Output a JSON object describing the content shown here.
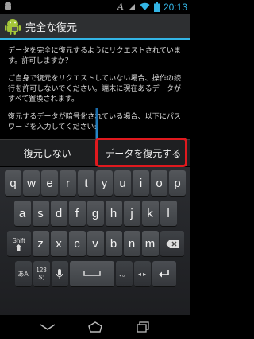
{
  "status_bar": {
    "time": "20:13",
    "left_icon": "android-debug-icon",
    "icons": [
      "a-font-icon",
      "signal-icon",
      "wifi-icon",
      "battery-icon"
    ]
  },
  "dialog": {
    "title": "完全な復元",
    "paragraphs": [
      "データを完全に復元するようにリクエストされています。許可しますか？",
      "ご自身で復元をリクエストしていない場合、操作の続行を許可しないでください。端末に現在あるデータがすべて置換されます。",
      "復元するデータが暗号化されている場合、以下にパスワードを入力してください:"
    ],
    "cancel_label": "復元しない",
    "confirm_label": "データを復元する"
  },
  "keyboard": {
    "row1": [
      "q",
      "w",
      "e",
      "r",
      "t",
      "y",
      "u",
      "i",
      "o",
      "p"
    ],
    "row2": [
      "a",
      "s",
      "d",
      "f",
      "g",
      "h",
      "j",
      "k",
      "l"
    ],
    "row3": [
      "z",
      "x",
      "c",
      "v",
      "b",
      "n",
      "m"
    ],
    "shift_label": "Shift",
    "lang_label": "あA",
    "num_label": "123 $;",
    "punct_label": "、。",
    "cursor_label": "◂ ▸"
  },
  "colors": {
    "accent": "#33b5e5",
    "highlight": "#e0191e"
  }
}
